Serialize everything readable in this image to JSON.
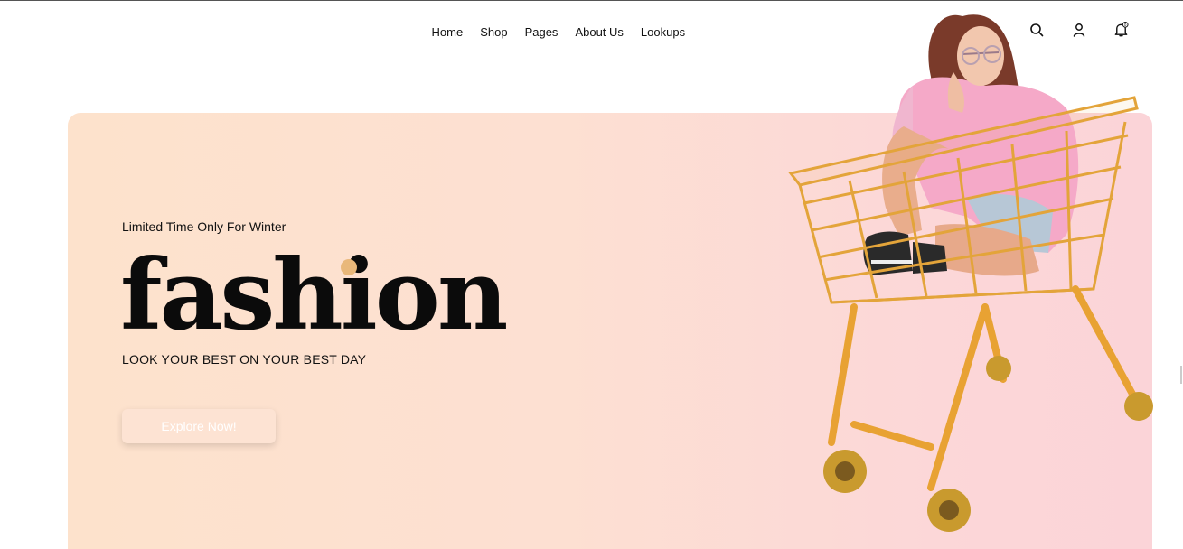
{
  "nav": {
    "items": [
      "Home",
      "Shop",
      "Pages",
      "About Us",
      "Lookups"
    ]
  },
  "header": {
    "icons": [
      "search-icon",
      "user-icon",
      "bell-icon"
    ],
    "notification_badge": "0"
  },
  "hero": {
    "eyebrow": "Limited Time Only For Winter",
    "headline": "fashion",
    "tagline": "LOOK YOUR BEST ON YOUR BEST DAY",
    "cta_label": "Explore Now!",
    "gradient_start": "#fde2cc",
    "gradient_end": "#fbd4d8",
    "accent_color": "#e9b87a",
    "image_subject": "woman-sitting-in-shopping-cart"
  }
}
